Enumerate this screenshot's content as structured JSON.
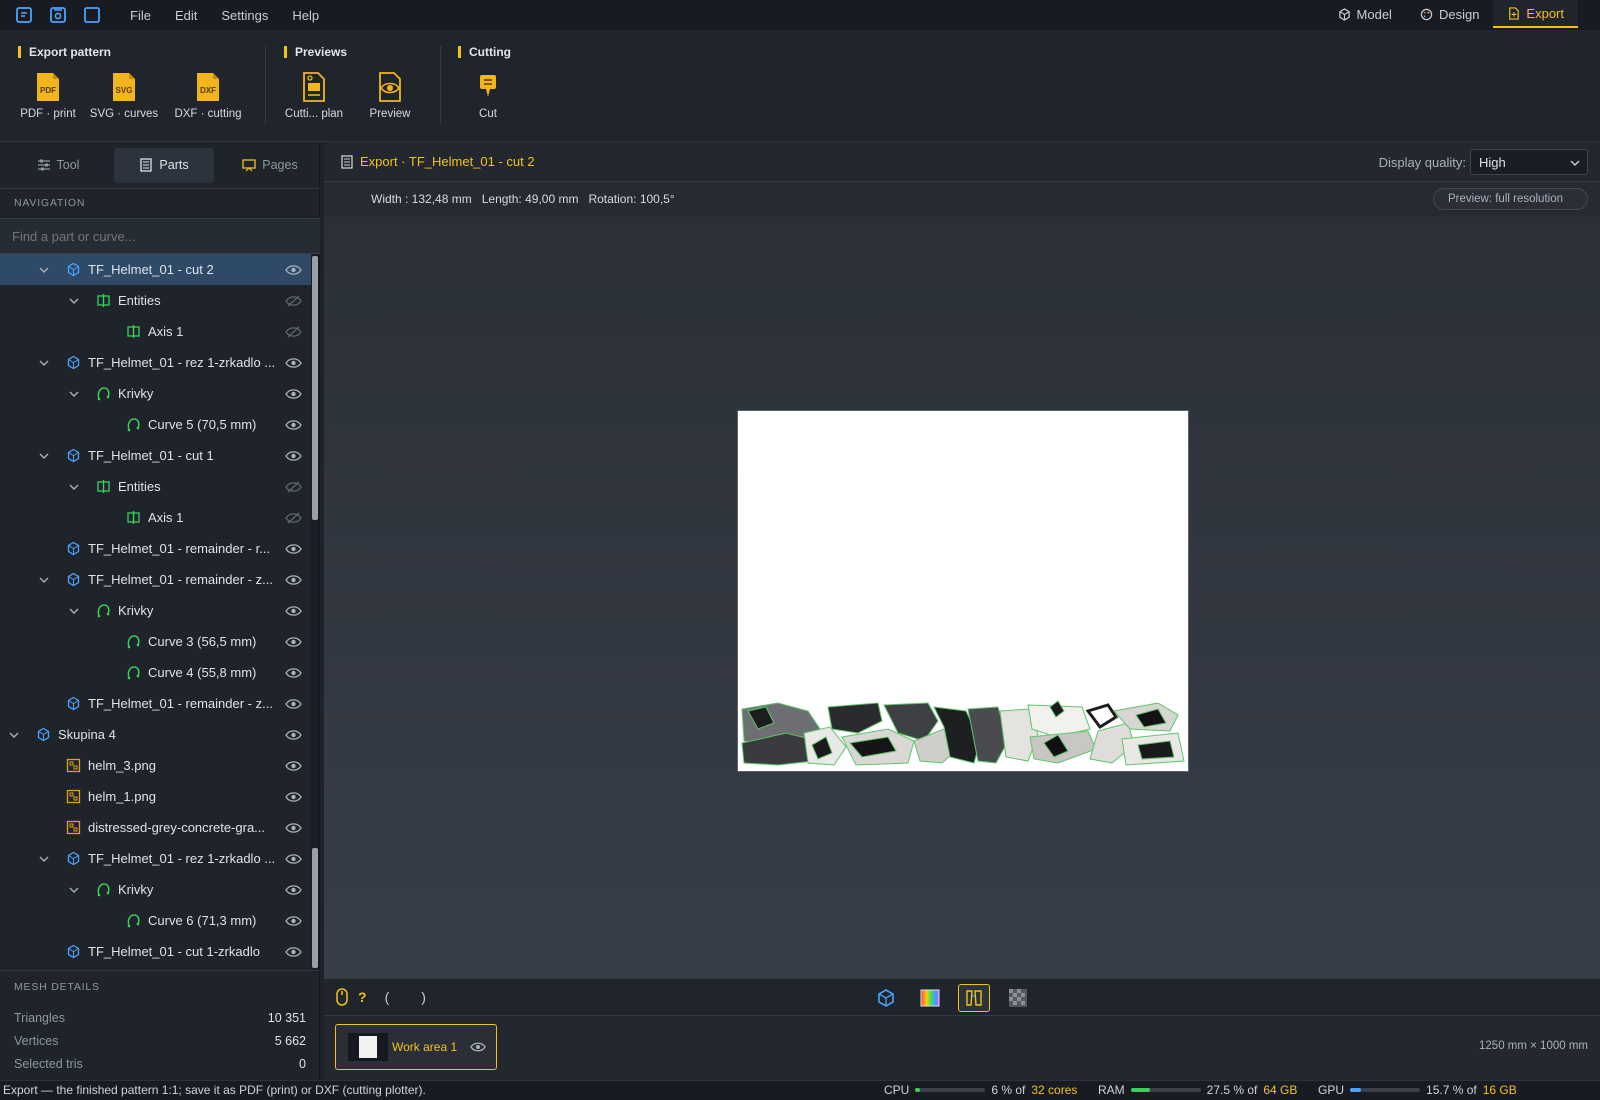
{
  "menubar": {
    "menus": [
      "File",
      "Edit",
      "Settings",
      "Help"
    ],
    "modes": [
      {
        "label": "Model",
        "icon": "cube-icon",
        "active": false
      },
      {
        "label": "Design",
        "icon": "palette-icon",
        "active": false
      },
      {
        "label": "Export",
        "icon": "export-doc-icon",
        "active": true
      }
    ]
  },
  "ribbon": {
    "groups": [
      {
        "title": "Export pattern",
        "buttons": [
          {
            "label": "PDF · print",
            "icon": "pdf-file-icon",
            "badge": "PDF"
          },
          {
            "label": "SVG · curves",
            "icon": "svg-file-icon",
            "badge": "SVG"
          },
          {
            "label": "DXF · cutting",
            "icon": "dxf-file-icon",
            "badge": "DXF"
          }
        ]
      },
      {
        "title": "Previews",
        "buttons": [
          {
            "label": "Cutti... plan",
            "icon": "cutting-plan-icon"
          },
          {
            "label": "Preview",
            "icon": "eye-preview-icon"
          }
        ]
      },
      {
        "title": "Cutting",
        "buttons": [
          {
            "label": "Cut",
            "icon": "plotter-cut-icon"
          }
        ]
      }
    ]
  },
  "panel": {
    "tabs": [
      {
        "label": "Tool",
        "icon": "sliders-icon",
        "active": false
      },
      {
        "label": "Parts",
        "icon": "list-icon",
        "active": true
      },
      {
        "label": "Pages",
        "icon": "pages-icon",
        "active": false
      }
    ],
    "navigation_title": "NAVIGATION",
    "search_placeholder": "Find a part or curve...",
    "tree": [
      {
        "level": 1,
        "expanded": true,
        "icon": "part",
        "label": "TF_Helmet_01 - cut 2",
        "visible": true,
        "selected": true
      },
      {
        "level": 2,
        "expanded": true,
        "icon": "axis",
        "label": "Entities",
        "visible": false
      },
      {
        "level": 3,
        "expanded": null,
        "icon": "axis",
        "label": "Axis 1",
        "visible": false
      },
      {
        "level": 1,
        "expanded": true,
        "icon": "part",
        "label": "TF_Helmet_01 - rez 1-zrkadlo ...",
        "visible": true
      },
      {
        "level": 2,
        "expanded": true,
        "icon": "curve",
        "label": "Krivky",
        "visible": true
      },
      {
        "level": 3,
        "expanded": null,
        "icon": "curve",
        "label": "Curve 5  (70,5 mm)",
        "visible": true
      },
      {
        "level": 1,
        "expanded": true,
        "icon": "part",
        "label": "TF_Helmet_01 - cut 1",
        "visible": true
      },
      {
        "level": 2,
        "expanded": true,
        "icon": "axis",
        "label": "Entities",
        "visible": false
      },
      {
        "level": 3,
        "expanded": null,
        "icon": "axis",
        "label": "Axis 1",
        "visible": false
      },
      {
        "level": 1,
        "expanded": null,
        "icon": "part",
        "label": "TF_Helmet_01 - remainder - r...",
        "visible": true
      },
      {
        "level": 1,
        "expanded": true,
        "icon": "part",
        "label": "TF_Helmet_01 - remainder - z...",
        "visible": true
      },
      {
        "level": 2,
        "expanded": true,
        "icon": "curve",
        "label": "Krivky",
        "visible": true
      },
      {
        "level": 3,
        "expanded": null,
        "icon": "curve",
        "label": "Curve 3  (56,5 mm)",
        "visible": true
      },
      {
        "level": 3,
        "expanded": null,
        "icon": "curve",
        "label": "Curve 4  (55,8 mm)",
        "visible": true
      },
      {
        "level": 1,
        "expanded": null,
        "icon": "part",
        "label": "TF_Helmet_01 - remainder - z...",
        "visible": true
      },
      {
        "level": 0,
        "expanded": true,
        "icon": "part",
        "label": "Skupina 4",
        "visible": true
      },
      {
        "level": 1,
        "expanded": null,
        "icon": "image",
        "label": "helm_3.png",
        "visible": true
      },
      {
        "level": 1,
        "expanded": null,
        "icon": "image",
        "label": "helm_1.png",
        "visible": true
      },
      {
        "level": 1,
        "expanded": null,
        "icon": "image",
        "label": "distressed-grey-concrete-gra...",
        "visible": true
      },
      {
        "level": 1,
        "expanded": true,
        "icon": "part",
        "label": "TF_Helmet_01 - rez 1-zrkadlo ...",
        "visible": true
      },
      {
        "level": 2,
        "expanded": true,
        "icon": "curve",
        "label": "Krivky",
        "visible": true
      },
      {
        "level": 3,
        "expanded": null,
        "icon": "curve",
        "label": "Curve 6  (71,3 mm)",
        "visible": true
      },
      {
        "level": 1,
        "expanded": null,
        "icon": "part",
        "label": "TF_Helmet_01 - cut 1-zrkadlo",
        "visible": true
      }
    ],
    "mesh_title": "MESH DETAILS",
    "mesh": [
      {
        "key": "Triangles",
        "value": "10 351"
      },
      {
        "key": "Vertices",
        "value": "5 662"
      },
      {
        "key": "Selected tris",
        "value": "0"
      }
    ]
  },
  "main": {
    "title": "Export · TF_Helmet_01 - cut 2",
    "display_quality_label": "Display quality:",
    "display_quality_value": "High",
    "info": {
      "width": "Width : 132,48 mm",
      "length": "Length: 49,00 mm",
      "rotation": "Rotation: 100,5°"
    },
    "preview_button": "Preview: full resolution",
    "bottom_left": {
      "q": "?",
      "open": "(",
      "close": ")"
    },
    "workarea": {
      "label": "Work area 1",
      "size": "1250 mm × 1000 mm"
    }
  },
  "status": {
    "message": "Export — the finished pattern 1:1; save it as PDF (print) or DXF (cutting plotter).",
    "cpu": {
      "label": "CPU",
      "value": "6 % of",
      "total": "32 cores",
      "fraction": 0.06
    },
    "ram": {
      "label": "RAM",
      "value": "27.5 % of",
      "total": "64 GB",
      "fraction": 0.275
    },
    "gpu": {
      "label": "GPU",
      "value": "15.7 % of",
      "total": "16 GB",
      "fraction": 0.157
    }
  },
  "colors": {
    "accent": "#f2c21b",
    "part_icon": "#4aa3ff",
    "curve_icon": "#3ccf5a",
    "selection": "#2f4a66"
  }
}
